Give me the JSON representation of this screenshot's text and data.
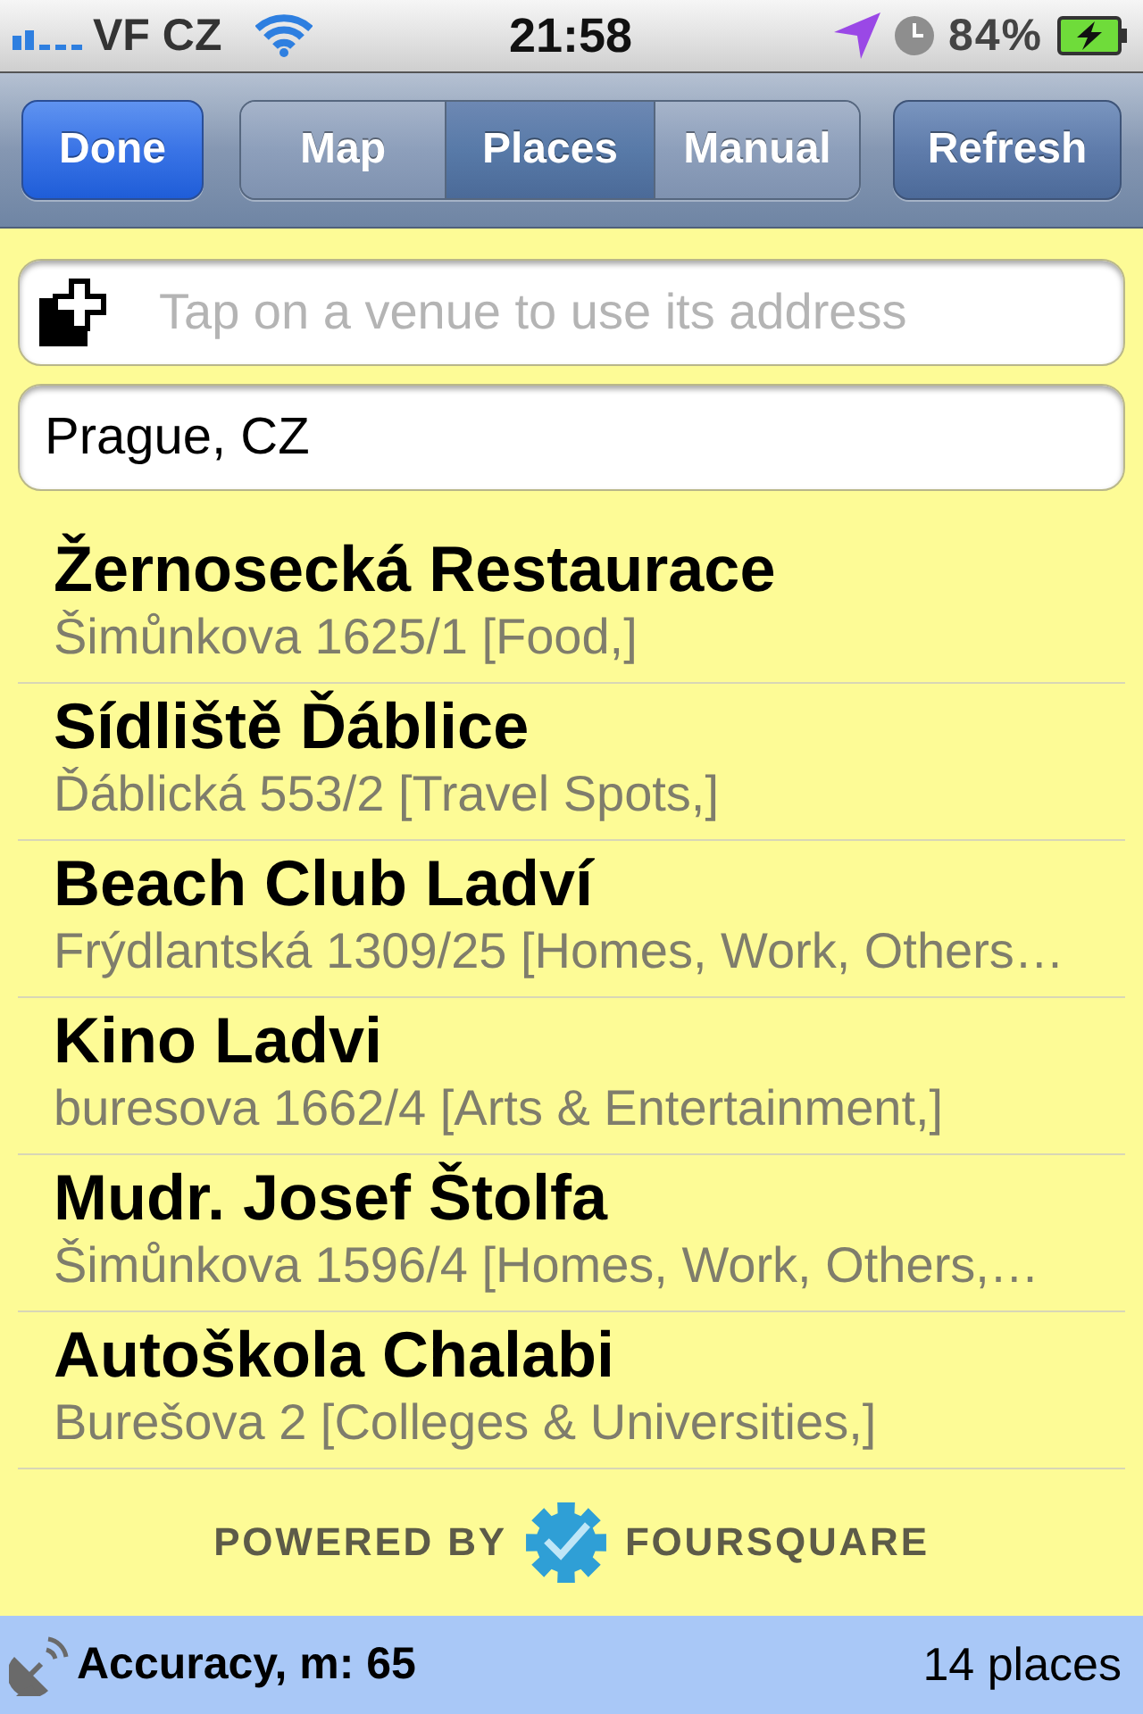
{
  "status_bar": {
    "carrier": "VF CZ",
    "time": "21:58",
    "battery": "84%"
  },
  "nav_bar": {
    "done_button": "Done",
    "segments": [
      {
        "label": "Map",
        "selected": false
      },
      {
        "label": "Places",
        "selected": true
      },
      {
        "label": "Manual",
        "selected": false
      }
    ],
    "refresh_button": "Refresh"
  },
  "venue_field": {
    "placeholder": "Tap on a venue to use its address"
  },
  "location_field": {
    "value": "Prague, CZ"
  },
  "venues": [
    {
      "name": "Žernosecká Restaurace",
      "details": "Šimůnkova 1625/1 [Food,]"
    },
    {
      "name": "Sídliště Ďáblice",
      "details": "Ďáblická 553/2 [Travel Spots,]"
    },
    {
      "name": "Beach Club Ladví",
      "details": "Frýdlantská 1309/25 [Homes, Work, Others…"
    },
    {
      "name": "Kino Ladvi",
      "details": "buresova 1662/4 [Arts & Entertainment,]"
    },
    {
      "name": "Mudr. Josef Štolfa",
      "details": "Šimůnkova 1596/4 [Homes, Work, Others,…"
    },
    {
      "name": "Autoškola Chalabi",
      "details": "Burešova 2 [Colleges & Universities,]"
    }
  ],
  "attribution": {
    "prefix": "POWERED BY",
    "brand": "FOURSQUARE"
  },
  "footer": {
    "accuracy": "Accuracy, m: 65",
    "count": "14 places"
  }
}
